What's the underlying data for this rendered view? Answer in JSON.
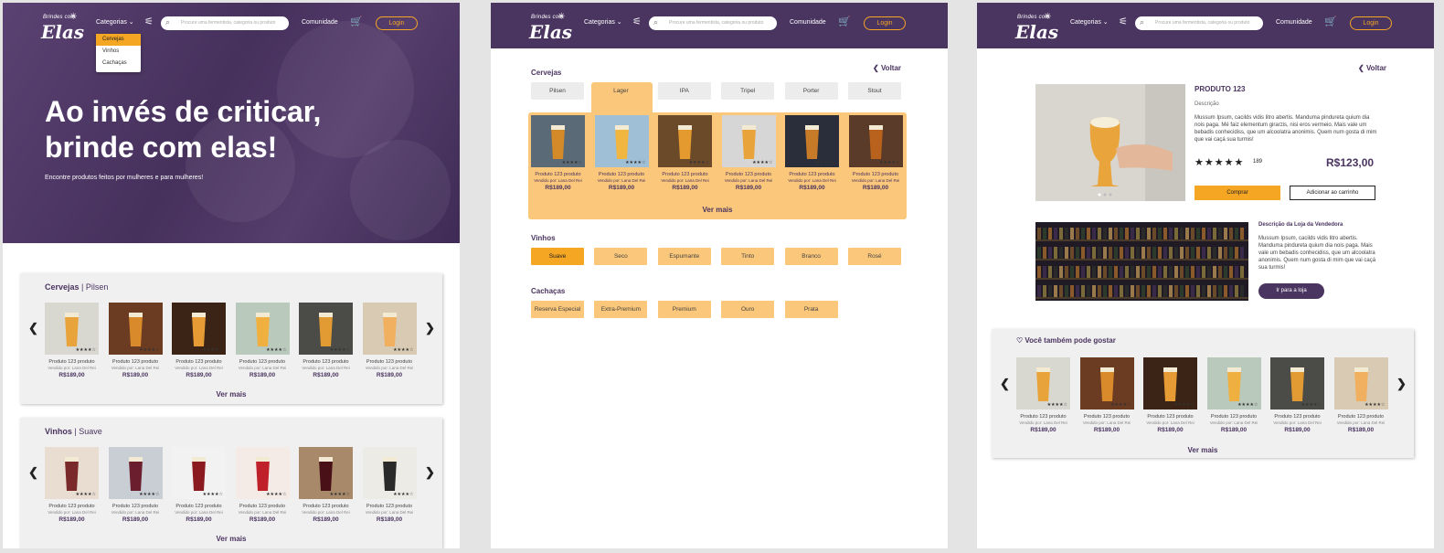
{
  "header": {
    "logo_small": "Brindes com",
    "logo_main": "Elas",
    "categories_label": "Categorias ⌄",
    "search_placeholder": "Procure uma fermentista, categoria ou produto",
    "community": "Comunidade",
    "login": "Login"
  },
  "dropdown": [
    "Cervejas",
    "Vinhos",
    "Cachaças"
  ],
  "hero": {
    "title": "Ao invés de criticar, brinde com elas!",
    "subtitle": "Encontre produtos feitos por mulheres e para mulheres!"
  },
  "product": {
    "name": "Produto 123 produto",
    "seller": "Vendido por: Lana Del Rei",
    "price": "R$189,00",
    "stars": "★★★★☆"
  },
  "home": {
    "beer_section": "Cervejas",
    "beer_sub": "Pilsen",
    "wine_section": "Vinhos",
    "wine_sub": "Suave",
    "see_more": "Ver mais",
    "prev": "❮",
    "next": "❯"
  },
  "categories_page": {
    "back": "Voltar",
    "beers_title": "Cervejas",
    "beers": [
      "Pilsen",
      "Lager",
      "IPA",
      "Tripel",
      "Porter",
      "Stout"
    ],
    "selected_beer": "Lager",
    "wines_title": "Vinhos",
    "wines": [
      "Suave",
      "Seco",
      "Espumante",
      "Tinto",
      "Branco",
      "Rosé"
    ],
    "selected_wine": "Suave",
    "cachacas_title": "Cachaças",
    "cachacas": [
      "Reserva Especial",
      "Extra-Premium",
      "Premium",
      "Ouro",
      "Prata"
    ],
    "see_more": "Ver mais"
  },
  "product_page": {
    "back": "Voltar",
    "title": "PRODUTO 123",
    "desc_label": "Descrição",
    "desc_text": "Mussum Ipsum, cacilds vidis litro abertis. Manduma pindureta quium dia nois paga. Mé faiz elementum girarzis, nisi eros vermeio. Mais vale um bebadis conhecidiss, que um alcoolatra anonimis. Quem num gosta di mim que vai caçá sua turmis!",
    "stars": "★★★★★",
    "review_count": "189",
    "price": "R$123,00",
    "buy": "Comprar",
    "add_cart": "Adicionar ao carrinho",
    "store_title": "Descrição da Loja da Vendedora",
    "store_text": "Mussum Ipsum, cacilds vidis litro abertis. Manduma pindureta quium dia nois paga. Mais vale um bebadis conhecidiss, que um alcoolatra anonimis. Quem num gosta di mim que vai caçá sua turmis!",
    "store_button": "Ir para a loja",
    "also_like": "Você também pode gostar",
    "see_more": "Ver mais"
  },
  "colors": {
    "primary": "#4a3460",
    "accent": "#f5a623",
    "chip": "#fbc77a"
  }
}
